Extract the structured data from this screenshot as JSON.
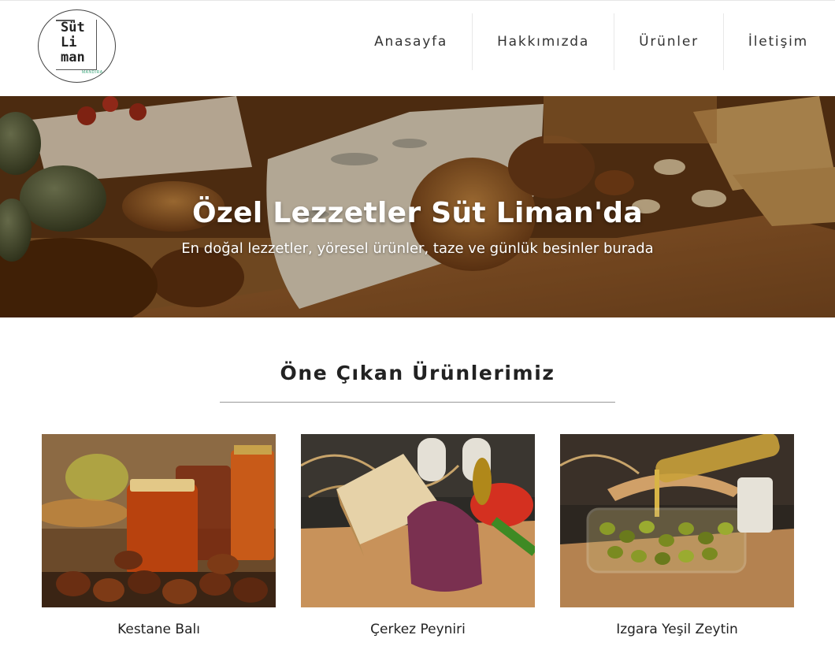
{
  "header": {
    "logo": {
      "line1": "Süt",
      "line2": "Li",
      "line3": "man",
      "tagline": "MANDIRA"
    },
    "nav": [
      {
        "label": "Anasayfa"
      },
      {
        "label": "Hakkımızda"
      },
      {
        "label": "Ürünler"
      },
      {
        "label": "İletişim"
      }
    ]
  },
  "hero": {
    "title": "Özel Lezzetler Süt Liman'da",
    "subtitle": "En doğal lezzetler, yöresel ürünler, taze ve günlük besinler burada"
  },
  "featured": {
    "title": "Öne Çıkan Ürünlerimiz",
    "products": [
      {
        "name": "Kestane Balı"
      },
      {
        "name": "Çerkez Peyniri"
      },
      {
        "name": "Izgara Yeşil Zeytin"
      }
    ]
  },
  "colors": {
    "accent": "#3aa57a",
    "text": "#222222",
    "divider": "#999999"
  }
}
